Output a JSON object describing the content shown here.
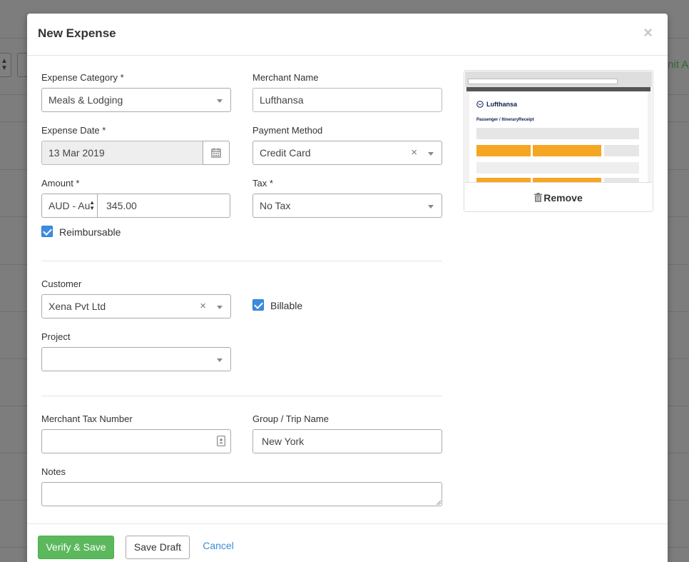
{
  "background": {
    "right_text": "nit All"
  },
  "modal": {
    "title": "New Expense",
    "close_symbol": "×"
  },
  "form": {
    "expense_category": {
      "label": "Expense Category *",
      "value": "Meals & Lodging"
    },
    "merchant_name": {
      "label": "Merchant Name",
      "value": "Lufthansa"
    },
    "expense_date": {
      "label": "Expense Date *",
      "value": "13 Mar 2019"
    },
    "payment_method": {
      "label": "Payment Method",
      "value": "Credit Card"
    },
    "amount": {
      "label": "Amount *",
      "currency": "AUD - Au",
      "value": "345.00"
    },
    "tax": {
      "label": "Tax *",
      "value": "No Tax"
    },
    "reimbursable": {
      "label": "Reimbursable",
      "checked": true
    },
    "customer": {
      "label": "Customer",
      "value": "Xena Pvt Ltd"
    },
    "billable": {
      "label": "Billable",
      "checked": true
    },
    "project": {
      "label": "Project",
      "value": ""
    },
    "merchant_tax_number": {
      "label": "Merchant Tax Number",
      "value": ""
    },
    "group_trip_name": {
      "label": "Group / Trip Name",
      "value": "New York"
    },
    "notes": {
      "label": "Notes",
      "value": ""
    }
  },
  "attachment": {
    "logo_text": "Lufthansa",
    "doc_title": "Passenger / ItineraryReceipt",
    "remove_label": "Remove"
  },
  "footer": {
    "verify_save": "Verify & Save",
    "save_draft": "Save Draft",
    "cancel": "Cancel"
  },
  "colors": {
    "accent_green": "#5cb85c",
    "accent_blue": "#3c8dde",
    "link_blue": "#3a8ed4",
    "receipt_orange": "#f5a623"
  },
  "icons": [
    "calendar-icon",
    "clear-icon",
    "dropdown-caret-icon",
    "trash-icon",
    "contact-card-icon",
    "close-icon"
  ]
}
